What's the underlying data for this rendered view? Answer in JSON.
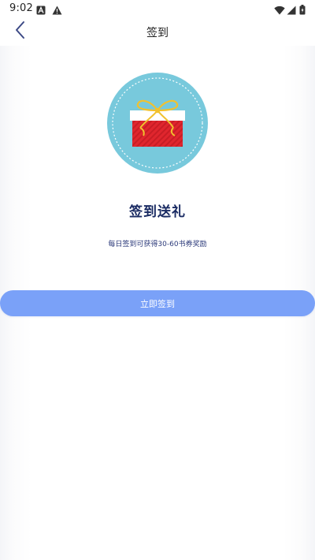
{
  "status_bar": {
    "time": "9:02",
    "left_icons": [
      "a-badge-icon",
      "warning-icon"
    ],
    "right_icons": [
      "wifi-icon",
      "signal-icon",
      "battery-icon"
    ]
  },
  "nav": {
    "back_icon": "chevron-left-icon",
    "title": "签到"
  },
  "main": {
    "gift_icon": "gift-box-icon",
    "headline": "签到送礼",
    "subtext": "每日签到可获得30-60书券奖励",
    "button_label": "立即签到"
  },
  "colors": {
    "badge_bg": "#78c9dc",
    "gift_red": "#e0262e",
    "ribbon_gold": "#f1c12e",
    "headline": "#1a2b63",
    "button_bg": "#7aa1f8"
  }
}
